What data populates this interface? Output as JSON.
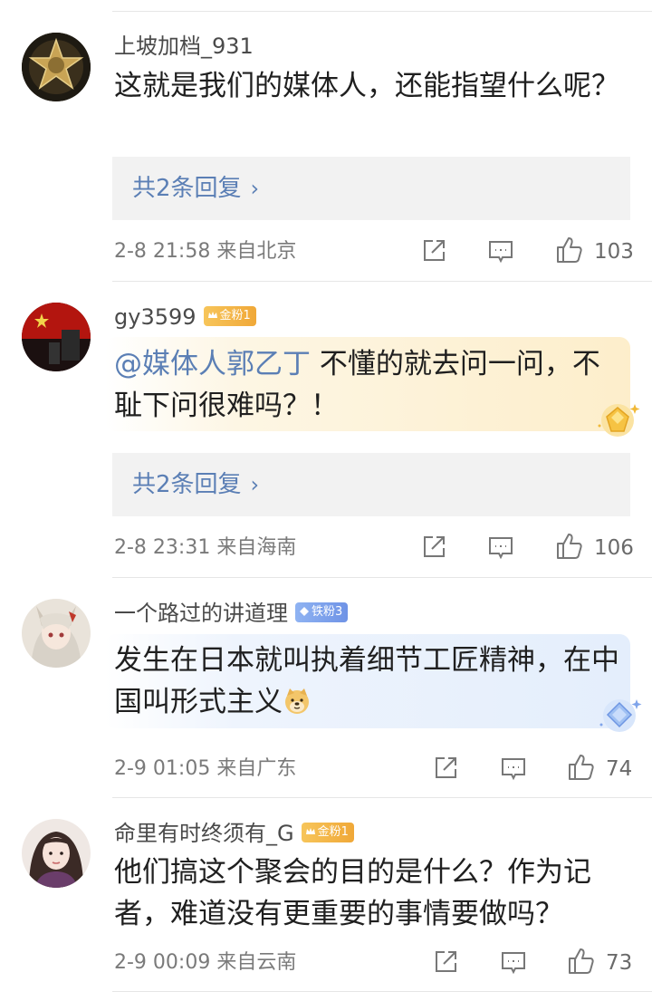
{
  "comments": [
    {
      "username": "上坡加档_931",
      "badge": null,
      "text": "这就是我们的媒体人，还能指望什么呢？",
      "replies_label": "共2条回复",
      "time": "2-8 21:58",
      "location": "来自北京",
      "likes": "103"
    },
    {
      "username": "gy3599",
      "badge": {
        "label": "金粉1",
        "color": "#f2b040"
      },
      "mention": "@媒体人郭乙丁",
      "text": " 不懂的就去问一问，不耻下问很难吗？！",
      "replies_label": "共2条回复",
      "time": "2-8 23:31",
      "location": "来自海南",
      "likes": "106"
    },
    {
      "username": "一个路过的讲道理",
      "badge": {
        "label": "铁粉3",
        "color": "#7f9fe9"
      },
      "text": "发生在日本就叫执着细节工匠精神，在中国叫形式主义",
      "emoji": "doge-emoji",
      "time": "2-9 01:05",
      "location": "来自广东",
      "likes": "74"
    },
    {
      "username": "命里有时终须有_G",
      "badge": {
        "label": "金粉1",
        "color": "#f2b040"
      },
      "text": "他们搞这个聚会的目的是什么？作为记者，难道没有更重要的事情要做吗？",
      "time": "2-9 00:09",
      "location": "来自云南",
      "likes": "73"
    }
  ],
  "icons": {
    "share": "share-icon",
    "comment": "comment-icon",
    "like": "thumbs-up-icon",
    "reply_chevron": "chevron-right-icon"
  },
  "colors": {
    "link": "#5b7fb5",
    "meta": "#7a7a7a",
    "reply_bg": "#f2f2f2",
    "gold_badge": "#f2b040",
    "iron_badge": "#7f9fe9"
  }
}
